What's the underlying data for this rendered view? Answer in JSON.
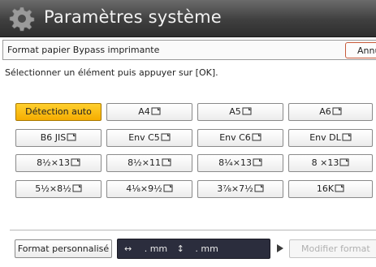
{
  "header": {
    "title": "Paramètres système",
    "gear_icon": "gear-icon"
  },
  "subheader": {
    "label": "Format papier Bypass imprimante",
    "cancel_label": "Annu"
  },
  "instruction": "Sélectionner un élément puis appuyer sur [OK].",
  "formats": [
    [
      {
        "label": "Détection auto",
        "icon": "",
        "selected": true
      },
      {
        "label": "A4",
        "icon": "paper-orientation-icon",
        "selected": false
      },
      {
        "label": "A5",
        "icon": "paper-orientation-icon",
        "selected": false
      },
      {
        "label": "A6",
        "icon": "paper-orientation-icon",
        "selected": false
      }
    ],
    [
      {
        "label": "B6 JIS",
        "icon": "paper-orientation-icon",
        "selected": false
      },
      {
        "label": "Env C5",
        "icon": "paper-orientation-icon",
        "selected": false
      },
      {
        "label": "Env C6",
        "icon": "paper-orientation-icon",
        "selected": false
      },
      {
        "label": "Env DL",
        "icon": "paper-orientation-icon",
        "selected": false
      }
    ],
    [
      {
        "label": "8½×13",
        "icon": "paper-orientation-icon",
        "selected": false
      },
      {
        "label": "8½×11",
        "icon": "paper-orientation-icon",
        "selected": false
      },
      {
        "label": "8¼×13",
        "icon": "paper-orientation-icon",
        "selected": false
      },
      {
        "label": "8 ×13",
        "icon": "paper-orientation-icon",
        "selected": false
      }
    ],
    [
      {
        "label": "5½×8½",
        "icon": "paper-orientation-icon",
        "selected": false
      },
      {
        "label": "4⅛×9½",
        "icon": "paper-orientation-icon",
        "selected": false
      },
      {
        "label": "3⅞×7½",
        "icon": "paper-orientation-icon",
        "selected": false
      },
      {
        "label": "16K",
        "icon": "paper-orientation-icon",
        "selected": false
      }
    ]
  ],
  "footer": {
    "custom_label": "Format personnalisé",
    "width_symbol": "↔",
    "width_value": ". mm",
    "height_symbol": "↕",
    "height_value": ". mm",
    "modify_label": "Modifier format"
  },
  "colors": {
    "selected": "#f7b500",
    "title_bar": "#3f3f3f",
    "display_bg": "#2b2d3d",
    "cancel_border": "#c85a3a"
  }
}
